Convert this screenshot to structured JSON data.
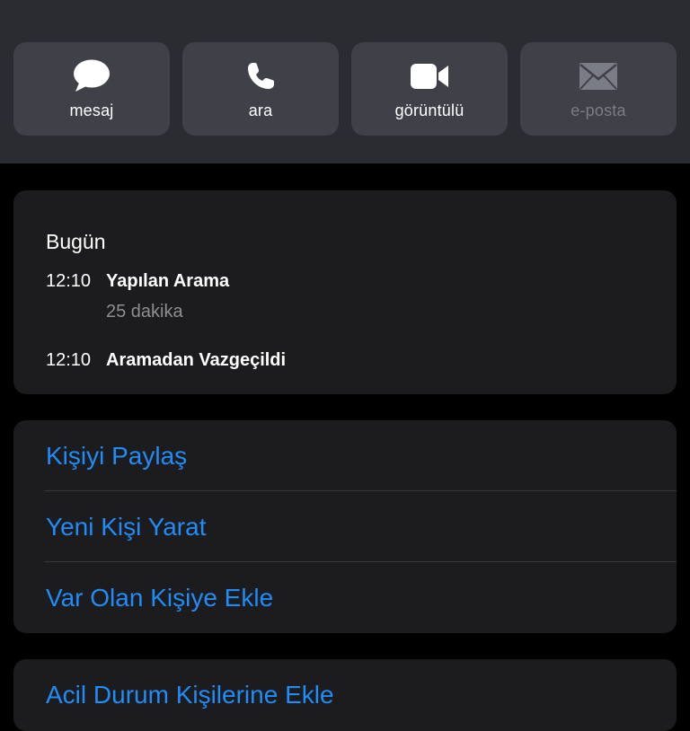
{
  "quick_actions": [
    {
      "label": "mesaj",
      "icon": "message-bubble-icon",
      "enabled": true
    },
    {
      "label": "ara",
      "icon": "phone-icon",
      "enabled": true
    },
    {
      "label": "görüntülü",
      "icon": "video-camera-icon",
      "enabled": true
    },
    {
      "label": "e-posta",
      "icon": "envelope-icon",
      "enabled": false
    }
  ],
  "history": {
    "title": "Bugün",
    "entries": [
      {
        "time": "12:10",
        "event": "Yapılan Arama",
        "detail": "25 dakika"
      },
      {
        "time": "12:10",
        "event": "Aramadan Vazgeçildi",
        "detail": ""
      }
    ]
  },
  "contact_actions": [
    {
      "label": "Kişiyi Paylaş"
    },
    {
      "label": "Yeni Kişi Yarat"
    },
    {
      "label": "Var Olan Kişiye Ekle"
    }
  ],
  "bottom_action": {
    "label": "Acil Durum Kişilerine Ekle"
  },
  "colors": {
    "accent": "#1f8cf7",
    "header_bg": "#2b2c31",
    "button_bg": "#3f4048",
    "card_bg": "#1c1c1e",
    "secondary_text": "#8e8e93",
    "disabled_text": "#7b7d86"
  }
}
